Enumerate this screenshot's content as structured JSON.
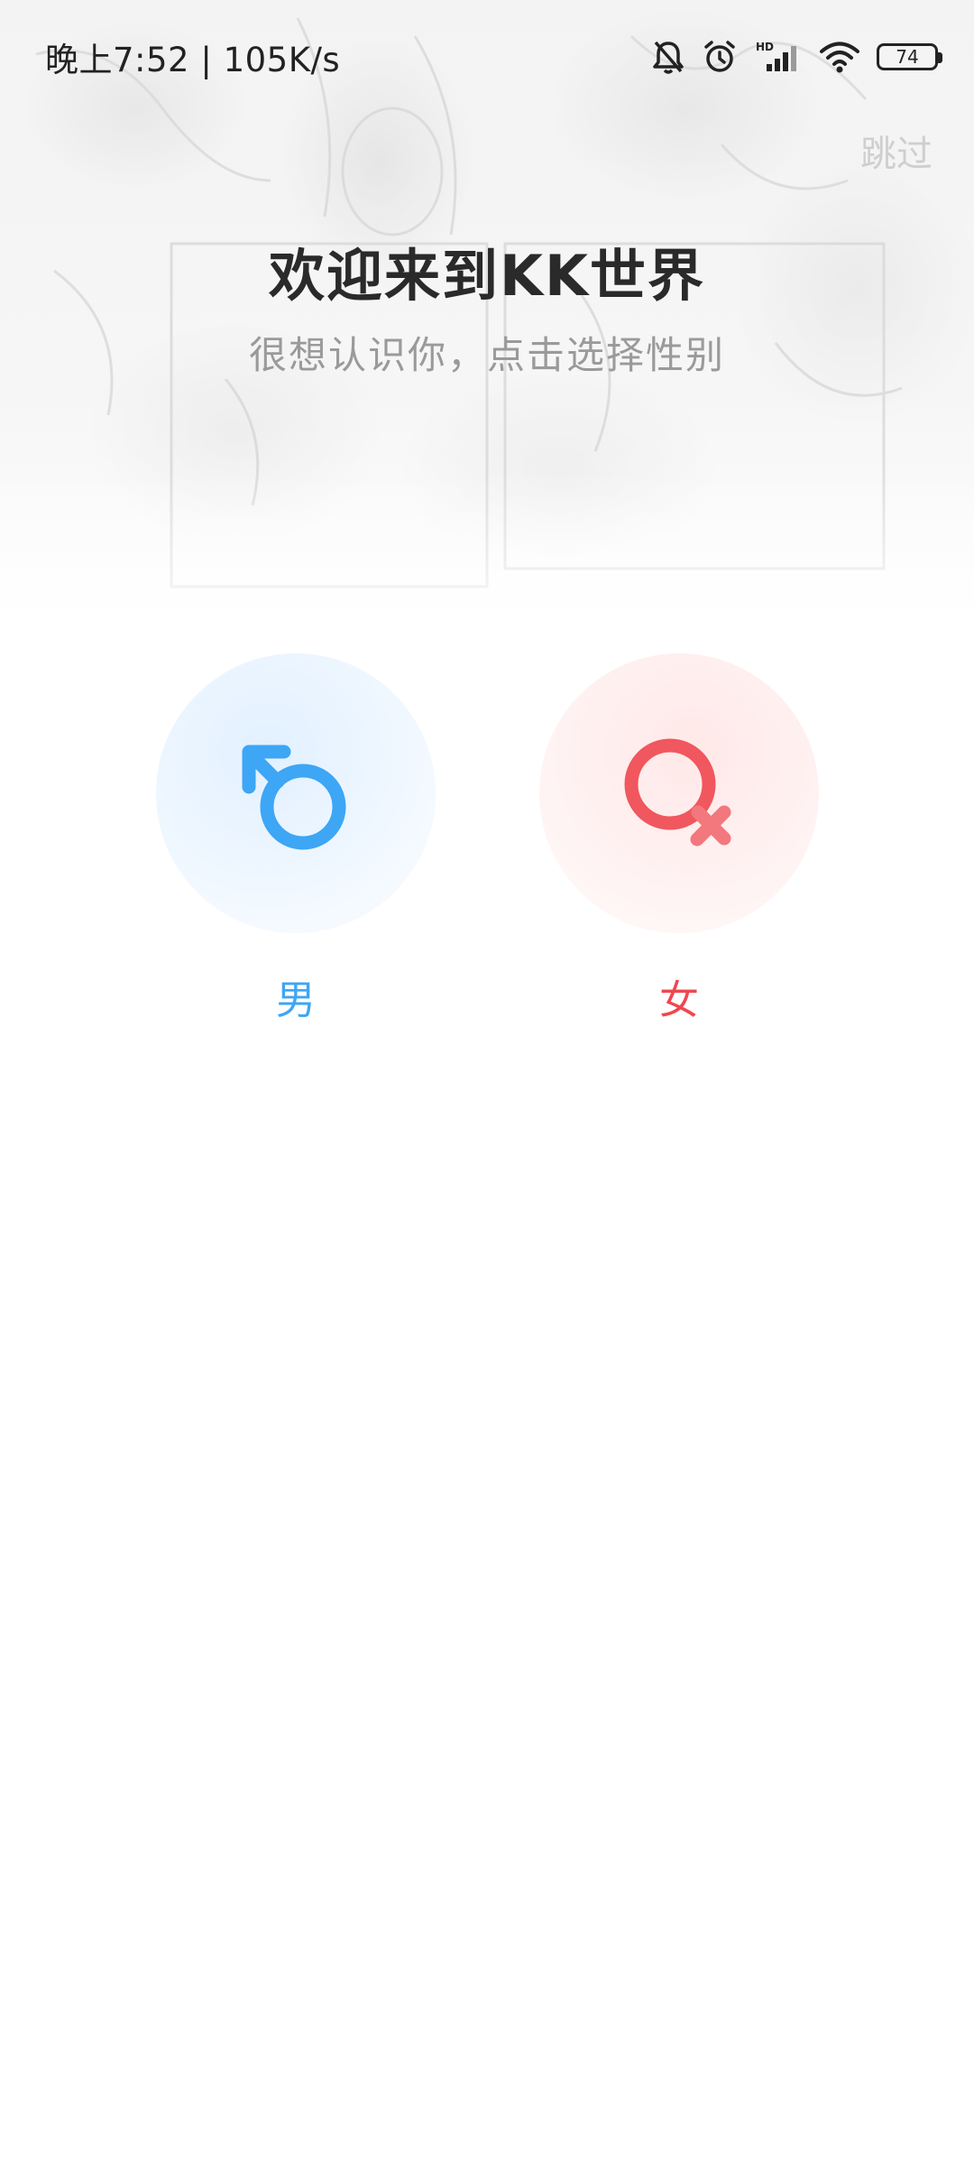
{
  "status_bar": {
    "time": "晚上7:52 | 105K/s",
    "battery": "74",
    "icons": [
      "bell-off-icon",
      "alarm-icon",
      "hd-signal-icon",
      "wifi-icon",
      "battery-icon"
    ]
  },
  "header": {
    "skip_label": "跳过",
    "title": "欢迎来到KK世界",
    "subtitle": "很想认识你，点击选择性别"
  },
  "genders": {
    "male": {
      "label": "男",
      "icon": "male-symbol-icon",
      "color": "#3da6f5"
    },
    "female": {
      "label": "女",
      "icon": "female-symbol-icon",
      "color": "#f0474f"
    }
  }
}
